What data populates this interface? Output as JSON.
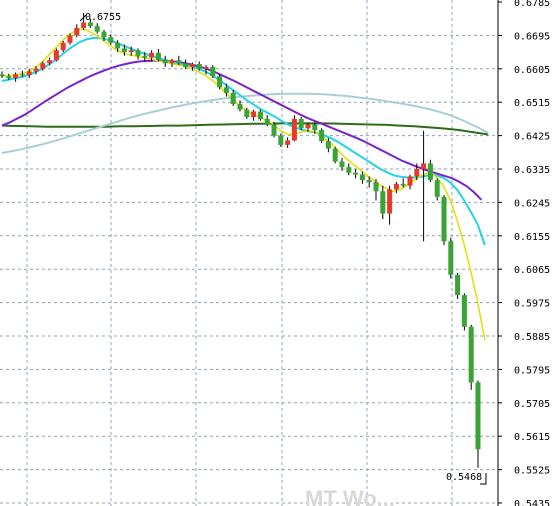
{
  "chart_data": {
    "type": "candlestick",
    "y_axis": {
      "position": "right",
      "ylim": [
        0.5415,
        0.68
      ],
      "ticks": [
        "0.6785",
        "0.6695",
        "0.6605",
        "0.6515",
        "0.6425",
        "0.6335",
        "0.6245",
        "0.6155",
        "0.6065",
        "0.5975",
        "0.5885",
        "0.5795",
        "0.5705",
        "0.5615",
        "0.5525",
        "0.5435"
      ]
    },
    "grid": true,
    "annotations": {
      "high_label": "0.6755",
      "low_label": "0.5468",
      "watermark": "MT Wo..."
    },
    "colors": {
      "up": "#e8392b",
      "down": "#3aa335",
      "ma_fast": "#e0e000",
      "ma_med": "#22d3e6",
      "ma_slow": "#7a22cc",
      "ma_long": "#a9cfd6",
      "ma_very_long": "#2e6b1a",
      "grid": "#8fa4b5"
    },
    "candles": [
      [
        0.659,
        0.6598,
        0.658,
        0.6585
      ],
      [
        0.6585,
        0.6592,
        0.6575,
        0.658
      ],
      [
        0.658,
        0.6595,
        0.657,
        0.659
      ],
      [
        0.659,
        0.66,
        0.6582,
        0.6588
      ],
      [
        0.6588,
        0.6605,
        0.658,
        0.6598
      ],
      [
        0.6598,
        0.6612,
        0.659,
        0.6605
      ],
      [
        0.6605,
        0.6625,
        0.66,
        0.662
      ],
      [
        0.662,
        0.6635,
        0.6615,
        0.6628
      ],
      [
        0.6628,
        0.666,
        0.6625,
        0.6655
      ],
      [
        0.6655,
        0.668,
        0.665,
        0.6675
      ],
      [
        0.6675,
        0.67,
        0.667,
        0.6695
      ],
      [
        0.6695,
        0.6725,
        0.669,
        0.6715
      ],
      [
        0.6715,
        0.6755,
        0.671,
        0.673
      ],
      [
        0.673,
        0.674,
        0.6715,
        0.672
      ],
      [
        0.672,
        0.6728,
        0.67,
        0.6705
      ],
      [
        0.6705,
        0.671,
        0.668,
        0.669
      ],
      [
        0.669,
        0.6698,
        0.667,
        0.6675
      ],
      [
        0.6675,
        0.6682,
        0.665,
        0.666
      ],
      [
        0.666,
        0.667,
        0.664,
        0.665
      ],
      [
        0.665,
        0.6665,
        0.664,
        0.6655
      ],
      [
        0.6655,
        0.666,
        0.663,
        0.664
      ],
      [
        0.664,
        0.665,
        0.6625,
        0.6635
      ],
      [
        0.6635,
        0.6655,
        0.6625,
        0.6648
      ],
      [
        0.6648,
        0.6658,
        0.6625,
        0.663
      ],
      [
        0.663,
        0.664,
        0.661,
        0.662
      ],
      [
        0.662,
        0.6632,
        0.661,
        0.6628
      ],
      [
        0.6628,
        0.664,
        0.6615,
        0.662
      ],
      [
        0.662,
        0.663,
        0.6605,
        0.661
      ],
      [
        0.661,
        0.6622,
        0.66,
        0.6618
      ],
      [
        0.6618,
        0.6625,
        0.66,
        0.6605
      ],
      [
        0.6605,
        0.6615,
        0.659,
        0.661
      ],
      [
        0.661,
        0.6615,
        0.658,
        0.6585
      ],
      [
        0.6585,
        0.659,
        0.655,
        0.6555
      ],
      [
        0.6555,
        0.6565,
        0.653,
        0.654
      ],
      [
        0.654,
        0.6548,
        0.6505,
        0.651
      ],
      [
        0.651,
        0.652,
        0.649,
        0.6495
      ],
      [
        0.6495,
        0.65,
        0.647,
        0.6475
      ],
      [
        0.6475,
        0.6495,
        0.6465,
        0.649
      ],
      [
        0.649,
        0.6495,
        0.6465,
        0.647
      ],
      [
        0.647,
        0.648,
        0.645,
        0.6455
      ],
      [
        0.6455,
        0.6462,
        0.642,
        0.6425
      ],
      [
        0.6425,
        0.643,
        0.6395,
        0.64
      ],
      [
        0.64,
        0.642,
        0.6392,
        0.6412
      ],
      [
        0.6412,
        0.648,
        0.641,
        0.647
      ],
      [
        0.647,
        0.6475,
        0.644,
        0.6445
      ],
      [
        0.6445,
        0.646,
        0.6435,
        0.6455
      ],
      [
        0.6455,
        0.646,
        0.643,
        0.644
      ],
      [
        0.644,
        0.6445,
        0.6405,
        0.641
      ],
      [
        0.641,
        0.6418,
        0.638,
        0.639
      ],
      [
        0.639,
        0.6395,
        0.635,
        0.6355
      ],
      [
        0.6355,
        0.6365,
        0.633,
        0.634
      ],
      [
        0.634,
        0.635,
        0.6318,
        0.6325
      ],
      [
        0.6325,
        0.6335,
        0.631,
        0.632
      ],
      [
        0.632,
        0.6328,
        0.6295,
        0.6305
      ],
      [
        0.6305,
        0.6315,
        0.6285,
        0.63
      ],
      [
        0.63,
        0.6308,
        0.625,
        0.6275
      ],
      [
        0.6275,
        0.629,
        0.62,
        0.6215
      ],
      [
        0.6215,
        0.629,
        0.6185,
        0.628
      ],
      [
        0.628,
        0.63,
        0.627,
        0.6295
      ],
      [
        0.6295,
        0.631,
        0.6285,
        0.629
      ],
      [
        0.629,
        0.632,
        0.628,
        0.6315
      ],
      [
        0.6315,
        0.635,
        0.6305,
        0.6335
      ],
      [
        0.6335,
        0.6438,
        0.614,
        0.635
      ],
      [
        0.635,
        0.636,
        0.63,
        0.6305
      ],
      [
        0.6305,
        0.631,
        0.625,
        0.626
      ],
      [
        0.626,
        0.6265,
        0.613,
        0.614
      ],
      [
        0.614,
        0.615,
        0.604,
        0.605
      ],
      [
        0.605,
        0.6055,
        0.5985,
        0.5995
      ],
      [
        0.5995,
        0.6,
        0.59,
        0.591
      ],
      [
        0.591,
        0.5915,
        0.574,
        0.576
      ],
      [
        0.576,
        0.5765,
        0.553,
        0.558
      ]
    ],
    "ma_fast": [
      0.6585,
      0.6586,
      0.6589,
      0.6592,
      0.66,
      0.6612,
      0.6628,
      0.6648,
      0.6668,
      0.6688,
      0.6702,
      0.6712,
      0.671,
      0.67,
      0.6688,
      0.6674,
      0.666,
      0.665,
      0.6643,
      0.664,
      0.6636,
      0.6632,
      0.6628,
      0.6624,
      0.662,
      0.6616,
      0.6612,
      0.6606,
      0.6598,
      0.6588,
      0.6575,
      0.6558,
      0.654,
      0.6522,
      0.6505,
      0.6492,
      0.648,
      0.6474,
      0.6466,
      0.6452,
      0.6436,
      0.6428,
      0.643,
      0.6436,
      0.6438,
      0.6432,
      0.642,
      0.6404,
      0.6386,
      0.6366,
      0.635,
      0.6336,
      0.632,
      0.6306,
      0.6292,
      0.6282,
      0.6275,
      0.628,
      0.6292,
      0.6305,
      0.6318,
      0.6325,
      0.6315,
      0.6292,
      0.6255,
      0.62,
      0.6135,
      0.606,
      0.5975,
      0.5875
    ],
    "ma_med": [
      0.6572,
      0.6576,
      0.658,
      0.6584,
      0.659,
      0.6598,
      0.6608,
      0.662,
      0.6634,
      0.665,
      0.6664,
      0.6676,
      0.6684,
      0.6688,
      0.6688,
      0.6684,
      0.6678,
      0.667,
      0.6662,
      0.6655,
      0.6648,
      0.6642,
      0.6636,
      0.663,
      0.6625,
      0.662,
      0.6616,
      0.6612,
      0.6606,
      0.6598,
      0.6588,
      0.6575,
      0.6562,
      0.6548,
      0.6534,
      0.652,
      0.6508,
      0.6496,
      0.6486,
      0.6476,
      0.6464,
      0.6454,
      0.6446,
      0.644,
      0.6436,
      0.6432,
      0.6426,
      0.6418,
      0.6408,
      0.6396,
      0.6384,
      0.6372,
      0.636,
      0.6348,
      0.6336,
      0.6326,
      0.6318,
      0.6314,
      0.6312,
      0.6312,
      0.6314,
      0.6318,
      0.6318,
      0.6312,
      0.63,
      0.628,
      0.6252,
      0.622,
      0.6185,
      0.613
    ],
    "ma_slow": [
      0.6452,
      0.646,
      0.647,
      0.648,
      0.6492,
      0.6505,
      0.6518,
      0.653,
      0.6542,
      0.6554,
      0.6564,
      0.6574,
      0.6584,
      0.6592,
      0.66,
      0.6607,
      0.6613,
      0.6618,
      0.6622,
      0.6625,
      0.6626,
      0.6627,
      0.6627,
      0.6626,
      0.6624,
      0.6621,
      0.6617,
      0.6612,
      0.6606,
      0.6599,
      0.659,
      0.6581,
      0.6572,
      0.6562,
      0.6552,
      0.6542,
      0.6532,
      0.6522,
      0.6512,
      0.6502,
      0.6492,
      0.6482,
      0.6473,
      0.6465,
      0.6457,
      0.6449,
      0.6441,
      0.6433,
      0.6425,
      0.6417,
      0.6408,
      0.6398,
      0.6388,
      0.6378,
      0.6368,
      0.6358,
      0.635,
      0.6342,
      0.6335,
      0.6328,
      0.6322,
      0.6316,
      0.631,
      0.63,
      0.6288,
      0.6272,
      0.6252
    ],
    "ma_long": [
      0.6378,
      0.6383,
      0.6388,
      0.6394,
      0.64,
      0.6407,
      0.6414,
      0.6422,
      0.643,
      0.6438,
      0.6446,
      0.6454,
      0.6462,
      0.647,
      0.6477,
      0.6484,
      0.649,
      0.6496,
      0.6502,
      0.6507,
      0.6512,
      0.6516,
      0.652,
      0.6524,
      0.6527,
      0.653,
      0.6532,
      0.6534,
      0.6536,
      0.6537,
      0.6538,
      0.6538,
      0.6538,
      0.6537,
      0.6536,
      0.6534,
      0.6532,
      0.6529,
      0.6526,
      0.6523,
      0.6519,
      0.6515,
      0.6511,
      0.6506,
      0.6501,
      0.6495,
      0.6488,
      0.648,
      0.647,
      0.6458,
      0.6446,
      0.6432
    ],
    "ma_very_long": [
      0.6452,
      0.6451,
      0.645,
      0.6449,
      0.6449,
      0.6449,
      0.6449,
      0.6449,
      0.645,
      0.645,
      0.6451,
      0.6452,
      0.6452,
      0.6453,
      0.6454,
      0.6455,
      0.6456,
      0.6457,
      0.6457,
      0.6458,
      0.6458,
      0.6458,
      0.6458,
      0.6457,
      0.6456,
      0.6455,
      0.6454,
      0.6452,
      0.645,
      0.6447,
      0.6444,
      0.644,
      0.6434,
      0.6428
    ]
  }
}
